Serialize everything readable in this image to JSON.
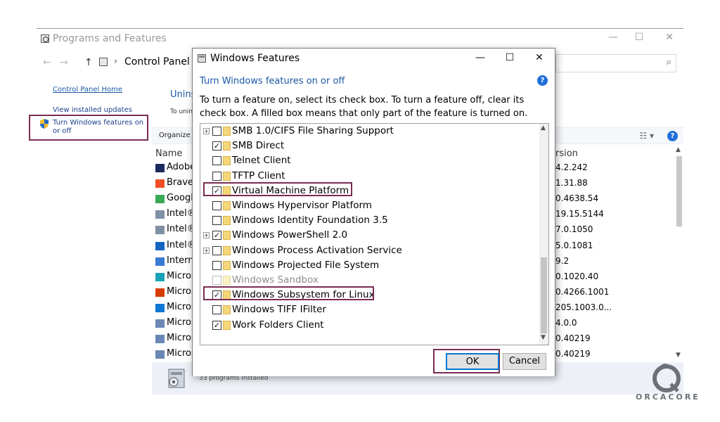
{
  "background_window": {
    "title": "Programs and Features",
    "window_controls": [
      "—",
      "☐",
      "✕"
    ],
    "breadcrumb": "Control Panel",
    "search_placeholder": "",
    "left_nav": {
      "home": "Control Panel Home",
      "updates": "View installed updates",
      "features": "Turn Windows features on or off"
    },
    "heading_partial": "Unins",
    "subtext_partial": "To unin",
    "toolbar": {
      "organize": "Organize ▾",
      "view": "☷ ▾",
      "help": "?"
    },
    "columns": {
      "name": "Name",
      "version": "rsion"
    },
    "rows": [
      {
        "name": "Adobe",
        "version": "4.2.242",
        "icon_color": "#1b2a5e"
      },
      {
        "name": "Brave",
        "version": "1.31.88",
        "icon_color": "#f04e23"
      },
      {
        "name": "Googl",
        "version": "0.4638.54",
        "icon_color": "#3aa757"
      },
      {
        "name": "Intel®",
        "version": "19.15.5144",
        "icon_color": "#7f8fa6"
      },
      {
        "name": "Intel®",
        "version": "7.0.1050",
        "icon_color": "#7f8fa6"
      },
      {
        "name": "Intel®",
        "version": "5.0.1081",
        "icon_color": "#1565c0"
      },
      {
        "name": "Intern",
        "version": "9.2",
        "icon_color": "#3a7bd5"
      },
      {
        "name": "Micros",
        "version": "0.1020.40",
        "icon_color": "#1aa3b8"
      },
      {
        "name": "Micros",
        "version": "0.4266.1001",
        "icon_color": "#d83b01"
      },
      {
        "name": "Micros",
        "version": "205.1003.0...",
        "icon_color": "#0f78d4"
      },
      {
        "name": "Micros",
        "version": "4.0.0",
        "icon_color": "#6b87b5"
      },
      {
        "name": "Micros",
        "version": "0.40219",
        "icon_color": "#6b87b5"
      },
      {
        "name": "Micros",
        "version": "0.40219",
        "icon_color": "#6b87b5"
      }
    ],
    "status": "33 programs installed"
  },
  "dialog": {
    "title": "Windows Features",
    "controls": [
      "—",
      "☐",
      "✕"
    ],
    "heading": "Turn Windows features on or off",
    "help": "?",
    "description": "To turn a feature on, select its check box. To turn a feature off, clear its check box. A filled box means that only part of the feature is turned on.",
    "features": [
      {
        "label": "SMB 1.0/CIFS File Sharing Support",
        "checked": false,
        "expandable": true
      },
      {
        "label": "SMB Direct",
        "checked": true,
        "expandable": false
      },
      {
        "label": "Telnet Client",
        "checked": false,
        "expandable": false
      },
      {
        "label": "TFTP Client",
        "checked": false,
        "expandable": false
      },
      {
        "label": "Virtual Machine Platform",
        "checked": true,
        "expandable": false
      },
      {
        "label": "Windows Hypervisor Platform",
        "checked": false,
        "expandable": false
      },
      {
        "label": "Windows Identity Foundation 3.5",
        "checked": false,
        "expandable": false
      },
      {
        "label": "Windows PowerShell 2.0",
        "checked": true,
        "expandable": true
      },
      {
        "label": "Windows Process Activation Service",
        "checked": false,
        "expandable": true
      },
      {
        "label": "Windows Projected File System",
        "checked": false,
        "expandable": false
      },
      {
        "label": "Windows Sandbox",
        "checked": false,
        "expandable": false,
        "disabled": true
      },
      {
        "label": "Windows Subsystem for Linux",
        "checked": true,
        "expandable": false
      },
      {
        "label": "Windows TIFF IFilter",
        "checked": false,
        "expandable": false
      },
      {
        "label": "Work Folders Client",
        "checked": true,
        "expandable": false
      }
    ],
    "ok_label": "OK",
    "cancel_label": "Cancel"
  },
  "watermark": {
    "text": "ORCACORE"
  },
  "colors": {
    "highlight": "#7b2c52",
    "link": "#1a57a6",
    "accent": "#0078d7",
    "folder": "#f5d77a"
  },
  "icons": [
    "control-panel-icon",
    "shield-icon",
    "help-icon",
    "search-icon",
    "features-window-icon",
    "folder-icon",
    "checkbox-icon",
    "expand-icon",
    "program-package-icon"
  ]
}
